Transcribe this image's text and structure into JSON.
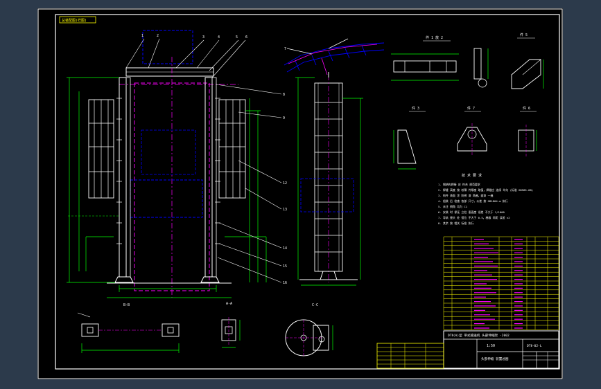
{
  "drawing": {
    "corner_tag": "总装配图(样图)",
    "view_labels": {
      "section_a": "A-A",
      "section_b": "B-B",
      "section_c": "C-C",
      "detail_1": "件 1 放 2",
      "detail_2": "件 6",
      "detail_3": "件 5",
      "detail_4": "件 3",
      "detail_5": "件 7",
      "section_aa2": "A-A"
    },
    "notes_title": "技 术 要 求",
    "notes": [
      "1. 钢结构焊接 应 符合 规范要求",
      "2. 焊缝 高度 按 较薄 件厚度 取值，焊缝应 连续 均匀 (标准 GB985-88)",
      "3. 构件 表面 涂 防锈 漆 两遍，面漆 一遍",
      "4. 组装 后 检查 各部 尺寸，公差 按 GB1804-m 执行",
      "5. 未注 倒角 均为 C1",
      "6. 安装 时 保证 立柱 垂直度 误差 不大于 1/1000",
      "7. 导轨 接头 处 错位 不大于 0.5，梯级 间距 误差 ±2",
      "8. 其余 按 相关 标准 执行"
    ],
    "title_block": {
      "title": "DTⅡ(A)型 带式输送机 头部伸缩架 -2002",
      "scale": "1:50",
      "drawing_no": "DTⅡ-02-L",
      "name": "头部伸缩 装置总图"
    }
  }
}
